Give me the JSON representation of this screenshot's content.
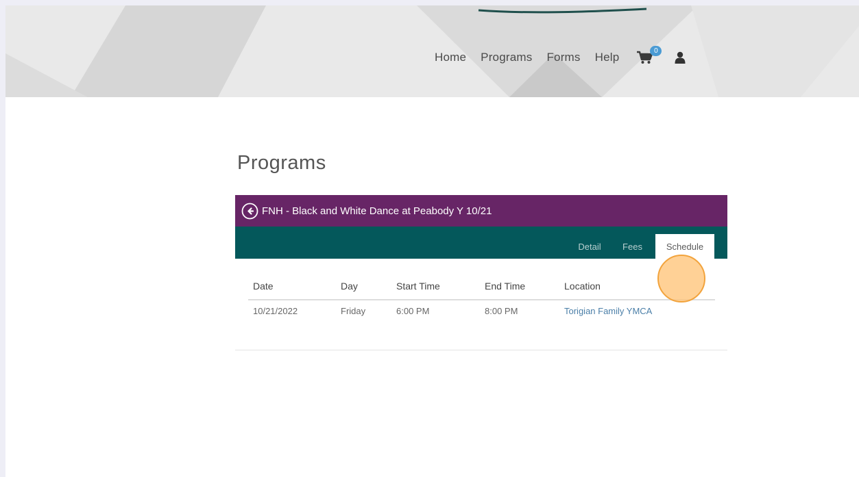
{
  "nav": {
    "links": [
      "Home",
      "Programs",
      "Forms",
      "Help"
    ],
    "cart_count": "0"
  },
  "icons": {
    "cart": "shopping-cart-icon",
    "user": "user-icon",
    "back": "arrow-left-circle-icon"
  },
  "page": {
    "title": "Programs"
  },
  "program": {
    "title": "FNH - Black and White Dance at Peabody Y 10/21",
    "tabs": [
      "Detail",
      "Fees",
      "Schedule"
    ],
    "active_tab": "Schedule"
  },
  "schedule": {
    "headers": [
      "Date",
      "Day",
      "Start Time",
      "End Time",
      "Location"
    ],
    "rows": [
      [
        "10/21/2022",
        "Friday",
        "6:00 PM",
        "8:00 PM",
        "Torigian Family YMCA"
      ]
    ]
  },
  "colors": {
    "title_bar": "#672566",
    "tab_bar": "#04585b",
    "link": "#4b7fa8",
    "badge": "#4a9bd4",
    "click_marker": "#f2a33c"
  }
}
